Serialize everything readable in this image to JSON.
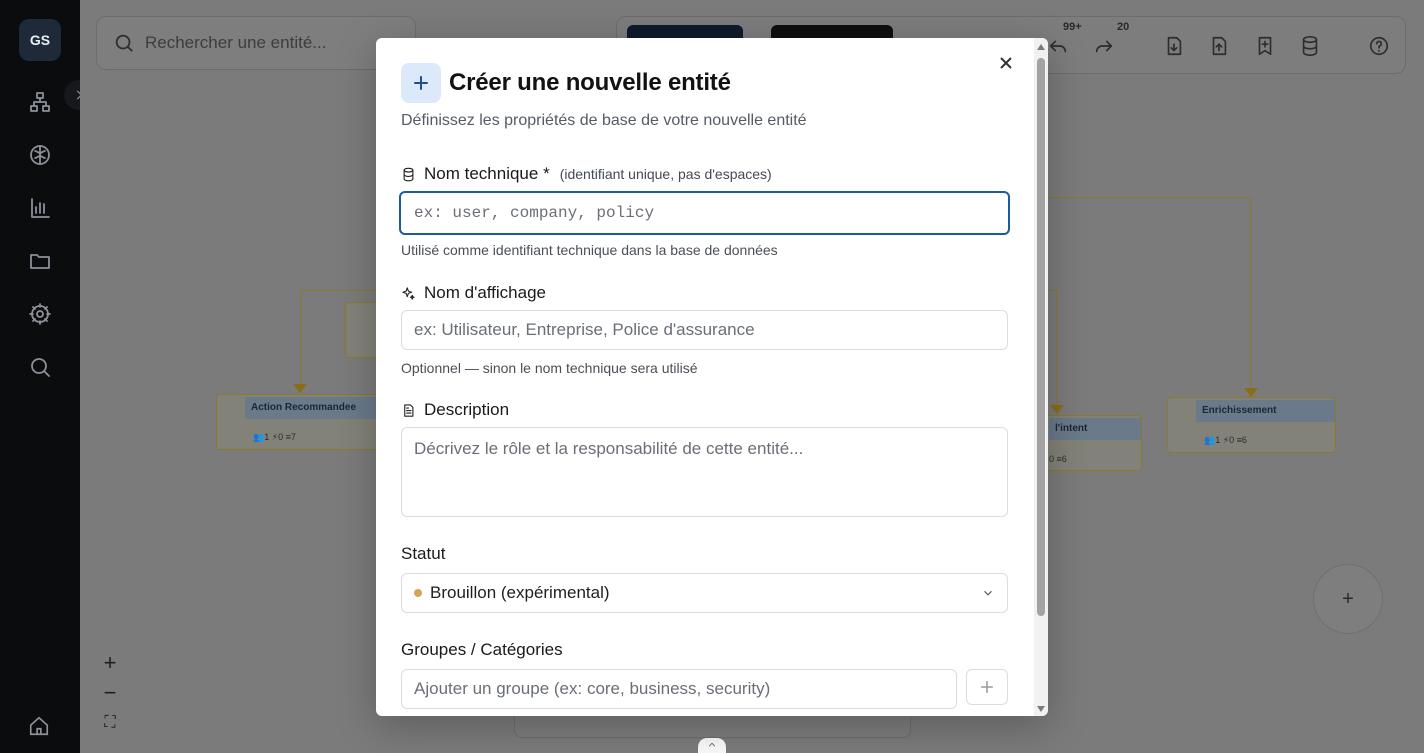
{
  "app": {
    "logo": "GS"
  },
  "search": {
    "placeholder": "Rechercher une entité..."
  },
  "toolbar": {
    "undo_count": "99+",
    "redo_count": "20"
  },
  "nodes": [
    {
      "title": "Action Recommandee",
      "attrs": "1",
      "actions": "0",
      "fields": "7"
    },
    {
      "title": "Enrichissement",
      "attrs": "1",
      "actions": "0",
      "fields": "6"
    },
    {
      "title": "l'intent",
      "actions": "0",
      "fields": "6"
    }
  ],
  "fab": {
    "label": "+"
  },
  "zoom": {
    "in": "+",
    "out": "−",
    "fit": "⛶"
  },
  "modal": {
    "title": "Créer une nouvelle entité",
    "subtitle": "Définissez les propriétés de base de votre nouvelle entité",
    "technical_name": {
      "label": "Nom technique *",
      "hint": "(identifiant unique, pas d'espaces)",
      "placeholder": "ex: user, company, policy",
      "helper": "Utilisé comme identifiant technique dans la base de données"
    },
    "display_name": {
      "label": "Nom d'affichage",
      "placeholder": "ex: Utilisateur, Entreprise, Police d'assurance",
      "helper": "Optionnel — sinon le nom technique sera utilisé"
    },
    "description": {
      "label": "Description",
      "placeholder": "Décrivez le rôle et la responsabilité de cette entité..."
    },
    "status": {
      "label": "Statut",
      "selected": "Brouillon (expérimental)",
      "dot_color": "#d6a35c"
    },
    "groups": {
      "label": "Groupes / Catégories",
      "placeholder": "Ajouter un groupe (ex: core, business, security)"
    }
  },
  "colors": {
    "accent": "#1e5aa0",
    "icon_bg": "#dce9fa"
  }
}
